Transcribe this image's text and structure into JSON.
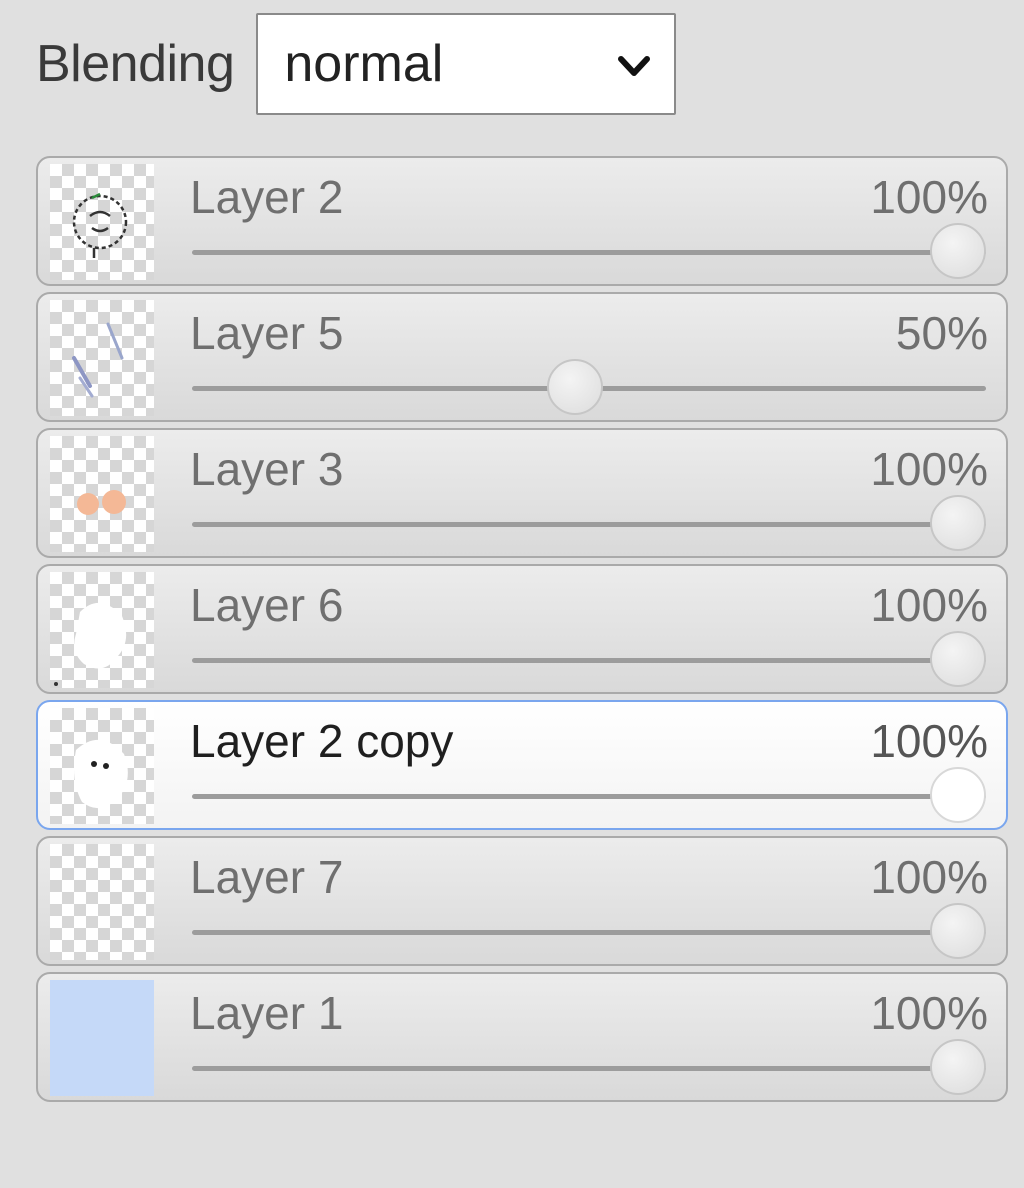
{
  "blending": {
    "label": "Blending",
    "value": "normal"
  },
  "layers": [
    {
      "name": "Layer 2",
      "opacity_label": "100%",
      "opacity": 1.0,
      "active": false,
      "thumb": "face-sketch"
    },
    {
      "name": "Layer 5",
      "opacity_label": "50%",
      "opacity": 0.5,
      "active": false,
      "thumb": "strokes"
    },
    {
      "name": "Layer 3",
      "opacity_label": "100%",
      "opacity": 1.0,
      "active": false,
      "thumb": "cheeks"
    },
    {
      "name": "Layer 6",
      "opacity_label": "100%",
      "opacity": 1.0,
      "active": false,
      "thumb": "white-fill"
    },
    {
      "name": "Layer 2 copy",
      "opacity_label": "100%",
      "opacity": 1.0,
      "active": true,
      "thumb": "face-copy"
    },
    {
      "name": "Layer 7",
      "opacity_label": "100%",
      "opacity": 1.0,
      "active": false,
      "thumb": "empty"
    },
    {
      "name": "Layer 1",
      "opacity_label": "100%",
      "opacity": 1.0,
      "active": false,
      "thumb": "solid-blue"
    }
  ],
  "colors": {
    "active_border": "#7aa6ee",
    "layer1_fill": "#c5d9f8",
    "cheek_color": "#f4b896"
  }
}
